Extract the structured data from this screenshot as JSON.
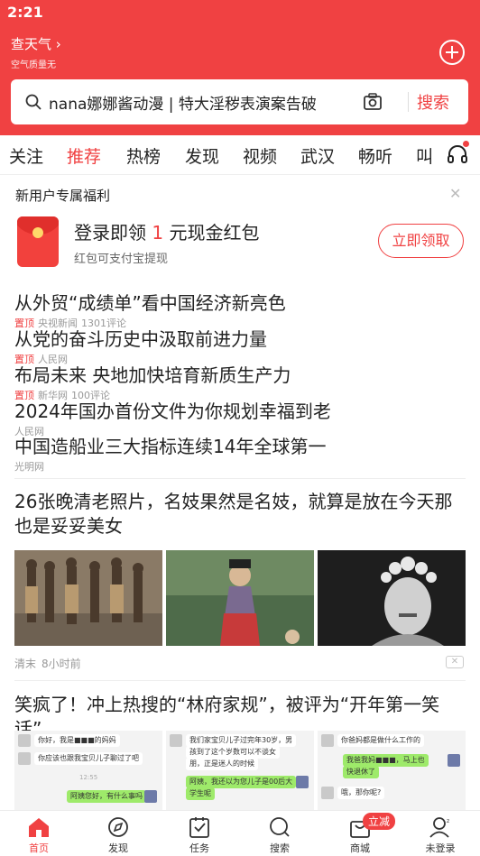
{
  "status": {
    "time": "2:21"
  },
  "header": {
    "weather_title": "查天气",
    "weather_sub": "空气质量无",
    "search_query": "nana娜娜酱动漫 | 特大淫秽表演案告破",
    "search_button": "搜索"
  },
  "tabs": [
    "关注",
    "推荐",
    "热榜",
    "发现",
    "视频",
    "武汉",
    "畅听",
    "叫"
  ],
  "active_tab": "推荐",
  "welfare": {
    "title": "新用户专属福利",
    "main_prefix": "登录即领",
    "amount": "1",
    "main_suffix": "元现金红包",
    "sub": "红包可支付宝提现",
    "button": "立即领取"
  },
  "news": [
    {
      "title": "从外贸“成绩单”看中国经济新亮色",
      "pinned": "置顶",
      "source": "央视新闻",
      "comments": "1301评论"
    },
    {
      "title": "从党的奋斗历史中汲取前进力量",
      "pinned": "置顶",
      "source": "人民网",
      "comments": ""
    },
    {
      "title": "布局未来 央地加快培育新质生产力",
      "pinned": "置顶",
      "source": "新华网",
      "comments": "100评论"
    },
    {
      "title": "2024年国办首份文件为你规划幸福到老",
      "pinned": "",
      "source": "人民网",
      "comments": ""
    },
    {
      "title": "中国造船业三大指标连续14年全球第一",
      "pinned": "",
      "source": "光明网",
      "comments": ""
    }
  ],
  "article1": {
    "title": "26张晚清老照片，名妓果然是名妓，就算是放在今天那也是妥妥美女",
    "source": "清末",
    "time": "8小时前"
  },
  "article2": {
    "title": "笑疯了！冲上热搜的“林府家规”，被评为“开年第一笑话”",
    "chat1": {
      "msg1": "你好，我是■■■的妈妈",
      "msg2": "你应该也跟我宝贝儿子聊过了吧",
      "time": "12:55",
      "msg3": "阿姨您好，有什么事吗"
    },
    "chat2": {
      "msg1": "我们家宝贝儿子过完年30岁，男",
      "msg2": "孩到了这个岁数可以不谈女",
      "msg3": "朋，正是迷人的时候",
      "msg4": "阿姨，我还以为您儿子是00后大",
      "msg5": "学生呢"
    },
    "chat3": {
      "msg1": "你爸妈都是做什么工作的",
      "msg2": "我爸我妈■■■，马上也",
      "msg3": "快退休了",
      "msg4": "哦，那你呢?"
    }
  },
  "bottom_nav": [
    {
      "label": "首页",
      "icon": "home-icon"
    },
    {
      "label": "发现",
      "icon": "compass-icon"
    },
    {
      "label": "任务",
      "icon": "task-icon"
    },
    {
      "label": "搜索",
      "icon": "search-icon"
    },
    {
      "label": "商城",
      "icon": "mall-icon"
    },
    {
      "label": "未登录",
      "icon": "user-icon"
    }
  ],
  "mall_badge": "立减",
  "colors": {
    "brand": "#f04142"
  }
}
